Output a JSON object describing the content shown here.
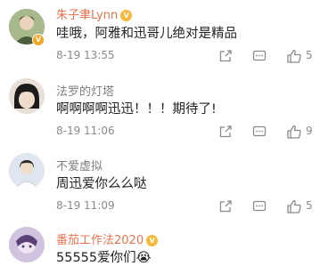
{
  "comments": [
    {
      "name": "朱子聿Lynn",
      "badge": "V",
      "medal": "V",
      "text": "哇哦，阿雅和迅哥儿绝对是精品",
      "time": "8-19 13:55",
      "likes": "5"
    },
    {
      "name": "法罗的灯塔",
      "text": "啊啊啊啊迅迅！！！期待了!",
      "time": "8-19 11:06",
      "likes": "9"
    },
    {
      "name": "不爱虚拟",
      "text": "周迅爱你么么哒",
      "time": "8-19 11:09",
      "likes": "5"
    },
    {
      "name": "番茄工作法2020",
      "medal": "V",
      "text": "55555爱你们😭",
      "time": ""
    }
  ],
  "colors": {
    "vip_name": "#eb7350",
    "name": "#808080",
    "text": "#222222",
    "meta": "#8a8a8a"
  }
}
